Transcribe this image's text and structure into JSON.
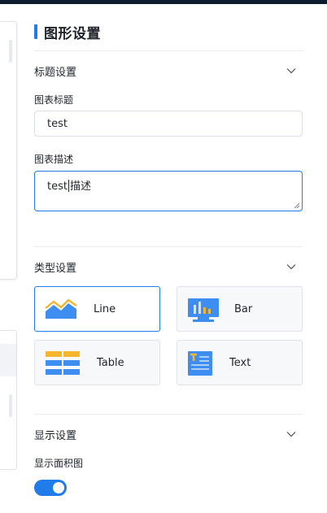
{
  "panel": {
    "title": "图形设置"
  },
  "sections": {
    "title_settings": {
      "label": "标题设置",
      "chart_title_label": "图表标题",
      "chart_title_value": "test",
      "chart_desc_label": "图表描述",
      "chart_desc_before_caret": "test",
      "chart_desc_after_caret": "描述"
    },
    "type_settings": {
      "label": "类型设置",
      "types": [
        {
          "label": "Line",
          "icon": "line-chart-icon",
          "selected": true
        },
        {
          "label": "Bar",
          "icon": "bar-chart-icon",
          "selected": false
        },
        {
          "label": "Table",
          "icon": "table-icon",
          "selected": false
        },
        {
          "label": "Text",
          "icon": "text-icon",
          "selected": false
        }
      ]
    },
    "display_settings": {
      "label": "显示设置",
      "area_chart_label": "显示面积图",
      "area_chart_enabled": true
    }
  },
  "colors": {
    "accent": "#1f7ce8",
    "icon_orange": "#f5b52e",
    "icon_blue": "#3d8ef0"
  }
}
